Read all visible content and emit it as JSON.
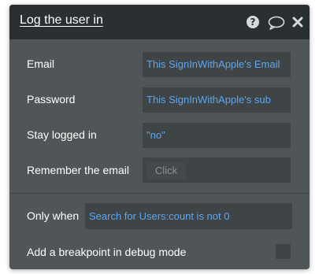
{
  "header": {
    "title": "Log the user in",
    "icons": [
      "help-icon",
      "comment-icon",
      "close-icon"
    ]
  },
  "fields": {
    "email": {
      "label": "Email",
      "value": "This SignInWithApple's Email"
    },
    "password": {
      "label": "Password",
      "value": "This SignInWithApple's sub"
    },
    "stay_logged_in": {
      "label": "Stay logged in",
      "value": "\"no\""
    },
    "remember_email": {
      "label": "Remember the email",
      "button": "Click"
    }
  },
  "condition": {
    "label": "Only when",
    "value": "Search for Users:count is not 0"
  },
  "debug": {
    "label": "Add a breakpoint in debug mode",
    "checked": false
  },
  "colors": {
    "header_bg": "#2a2f31",
    "panel_bg": "#505557",
    "field_bg": "#3f4446",
    "expression_text": "#5ea6ee"
  }
}
